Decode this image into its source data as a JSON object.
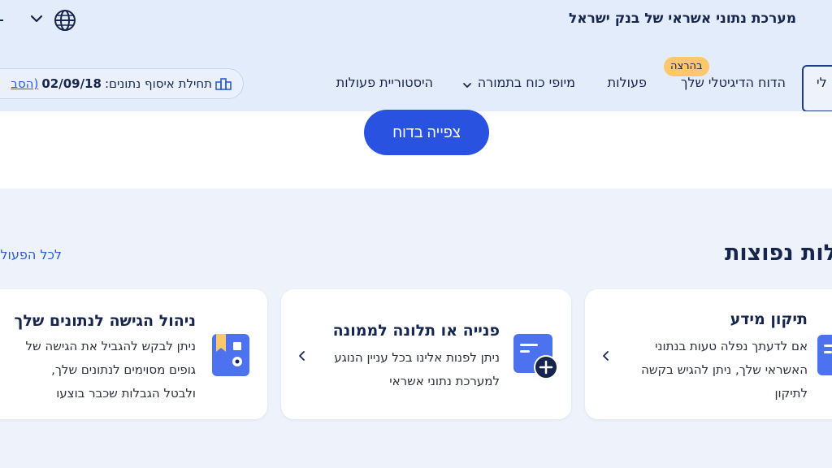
{
  "header": {
    "site_title": "מערכת נתוני אשראי של בנק ישראל"
  },
  "nav": {
    "active_tab": "לי",
    "tabs": [
      {
        "label": "הדוח הדיגיטלי שלך",
        "badge": "בהרצה"
      },
      {
        "label": "פעולות"
      },
      {
        "label": "מיופי כוח בתמורה",
        "has_dropdown": true
      },
      {
        "label": "היסטוריית פעולות"
      }
    ]
  },
  "data_collection": {
    "label": "תחילת איסוף נתונים:",
    "date": "02/09/18",
    "link_text": "(הסב"
  },
  "report": {
    "view_button": "צפייה בדוח"
  },
  "actions_section": {
    "title": "לות נפוצות",
    "all_link": "לכל הפעולו",
    "cards": [
      {
        "title": "תיקון מידע",
        "desc_lines": [
          "אם לדעתך נפלה טעות בנתוני",
          "האשראי שלך, ניתן להגיש בקשה",
          "לתיקון"
        ],
        "icon": "document-icon"
      },
      {
        "title": "פנייה או תלונה לממונה",
        "desc_lines": [
          "ניתן לפנות אלינו בכל עניין הנוגע",
          "למערכת נתוני אשראי"
        ],
        "icon": "add-document-icon"
      },
      {
        "title": "ניהול הגישה לנתונים שלך",
        "desc_lines": [
          "ניתן לבקש להגביל את הגישה של",
          "גופים מסוימים לנתונים שלך,",
          "ולבטל הגבלות שכבר בוצעו"
        ],
        "icon": "bookmark-box-icon"
      }
    ]
  },
  "colors": {
    "primary": "#2a52e0",
    "navy": "#16254d",
    "badge": "#fcc86b",
    "header_bg": "#e3ecfb",
    "page_bg": "#eef3fb"
  }
}
